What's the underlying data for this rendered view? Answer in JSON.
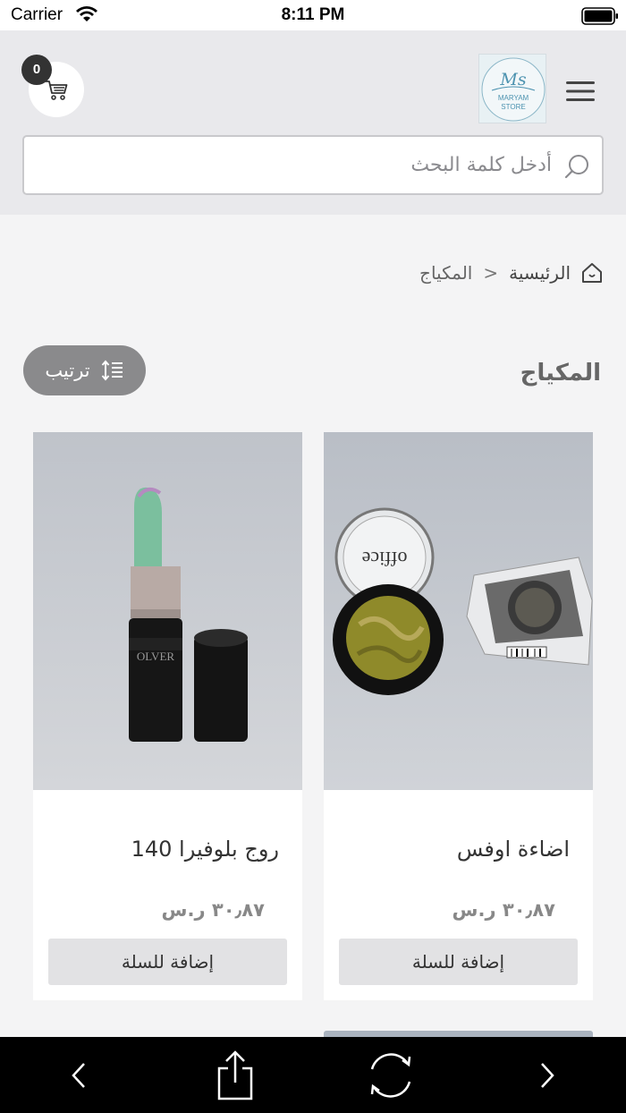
{
  "status_bar": {
    "carrier": "Carrier",
    "time": "8:11 PM"
  },
  "header": {
    "cart_count": "0",
    "logo": {
      "monogram": "Ms",
      "line1": "MARYAM",
      "line2": "STORE"
    },
    "search_placeholder": "أدخل كلمة البحث"
  },
  "breadcrumb": {
    "home": "الرئيسية",
    "separator": "<",
    "current": "المكياج"
  },
  "page": {
    "title": "المكياج",
    "sort_label": "ترتيب"
  },
  "products": [
    {
      "name": "اضاءة اوفس",
      "price": "٣٠٫٨٧ ر.س",
      "add_to_cart": "إضافة للسلة",
      "image_text": "office"
    },
    {
      "name": "روج بلوفيرا 140",
      "price": "٣٠٫٨٧ ر.س",
      "add_to_cart": "إضافة للسلة",
      "image_text": "OLVER"
    }
  ],
  "colors": {
    "header_bg": "#e9e9ec",
    "page_bg": "#f4f4f5",
    "sort_btn": "#8a8a8c",
    "badge": "#333333",
    "toolbar": "#000000"
  },
  "toolbar_icons": [
    "back-icon",
    "share-icon",
    "refresh-icon",
    "forward-icon"
  ]
}
